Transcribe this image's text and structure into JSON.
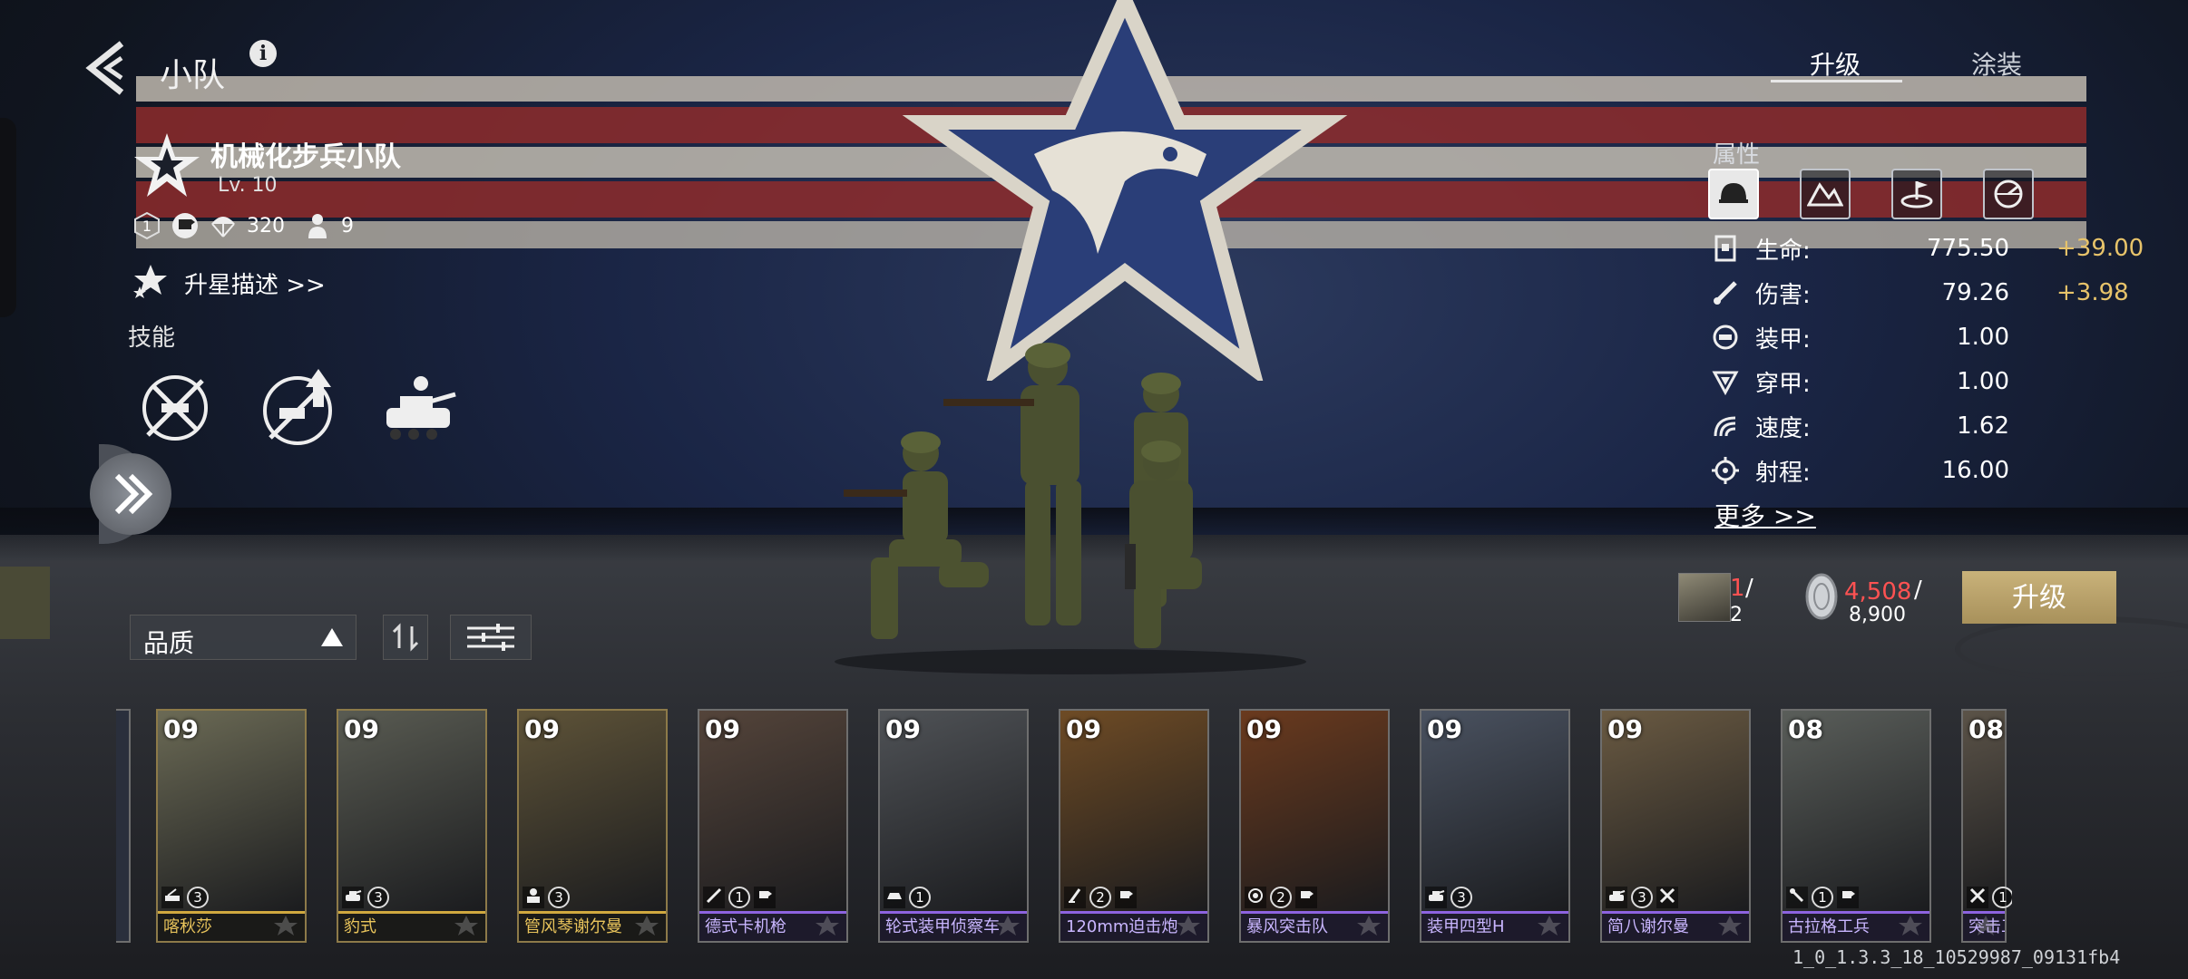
{
  "header": {
    "title": "小队",
    "info_icon": "i"
  },
  "tabs": [
    {
      "label": "升级",
      "active": true
    },
    {
      "label": "涂装",
      "active": false
    }
  ],
  "squad": {
    "name": "机械化步兵小队",
    "level": "Lv. 10",
    "tier": "1",
    "airdrop_cost": "320",
    "troop_count": "9",
    "star_upgrade_link": "升星描述 >>"
  },
  "skills": {
    "label": "技能",
    "items": [
      "skill-crossed-rifle-icon",
      "skill-rifle-upgrade-icon",
      "skill-tank-crew-icon"
    ]
  },
  "attributes": {
    "label": "属性",
    "tab_icons": [
      "helmet-icon",
      "terrain-icon",
      "target-icon",
      "speedometer-icon"
    ],
    "stats": [
      {
        "icon": "health-icon",
        "name": "生命:",
        "value": "775.50",
        "bonus": "+39.00"
      },
      {
        "icon": "damage-icon",
        "name": "伤害:",
        "value": "79.26",
        "bonus": "+3.98"
      },
      {
        "icon": "armor-icon",
        "name": "装甲:",
        "value": "1.00",
        "bonus": ""
      },
      {
        "icon": "penetration-icon",
        "name": "穿甲:",
        "value": "1.00",
        "bonus": ""
      },
      {
        "icon": "speed-icon",
        "name": "速度:",
        "value": "1.62",
        "bonus": ""
      },
      {
        "icon": "range-icon",
        "name": "射程:",
        "value": "16.00",
        "bonus": ""
      }
    ],
    "more_link": "更多 >>"
  },
  "upgrade": {
    "cost_cards_have": "1",
    "cost_cards_slash": "/",
    "cost_cards_need": "2",
    "cost_silver_have": "4,508",
    "cost_silver_slash": "/",
    "cost_silver_need": "8,900",
    "button_label": "升级"
  },
  "filter": {
    "quality_label": "品质"
  },
  "cards": [
    {
      "level": "09",
      "name": "喀秋莎",
      "rarity": "gold",
      "badges": [
        "rocket-icon",
        "3"
      ],
      "art": "#6b6a55"
    },
    {
      "level": "09",
      "name": "豹式",
      "rarity": "gold",
      "badges": [
        "tank-icon",
        "3"
      ],
      "art": "#595b52"
    },
    {
      "level": "09",
      "name": "管风琴谢尔曼",
      "rarity": "gold",
      "badges": [
        "artillery-icon",
        "3"
      ],
      "art": "#5e5338"
    },
    {
      "level": "09",
      "name": "德式卡机枪",
      "rarity": "purple",
      "badges": [
        "mg-icon",
        "1",
        "flag-icon"
      ],
      "art": "#54443a"
    },
    {
      "level": "09",
      "name": "轮式装甲侦察车",
      "rarity": "purple",
      "badges": [
        "vehicle-icon",
        "1"
      ],
      "art": "#4f5256"
    },
    {
      "level": "09",
      "name": "120mm迫击炮",
      "rarity": "purple",
      "badges": [
        "mortar-icon",
        "2",
        "flag-icon"
      ],
      "art": "#6e4b25"
    },
    {
      "level": "09",
      "name": "暴风突击队",
      "rarity": "purple",
      "badges": [
        "assault-icon",
        "2",
        "flag-icon"
      ],
      "art": "#6a3a1e"
    },
    {
      "level": "09",
      "name": "装甲四型H",
      "rarity": "purple",
      "badges": [
        "tank-icon",
        "3"
      ],
      "art": "#4a5260"
    },
    {
      "level": "09",
      "name": "简八谢尔曼",
      "rarity": "purple",
      "badges": [
        "tank-icon",
        "3",
        "tools-icon"
      ],
      "art": "#6a5a42"
    },
    {
      "level": "08",
      "name": "古拉格工兵",
      "rarity": "purple",
      "badges": [
        "engineer-icon",
        "1",
        "flag-icon"
      ],
      "art": "#5a5e5a"
    },
    {
      "level": "08",
      "name": "突击工兵",
      "rarity": "purple",
      "badges": [
        "tools-icon",
        "1"
      ],
      "art": "#5b5348"
    }
  ],
  "build_id": "1_0_1.3.3_18_10529987_09131fb4"
}
